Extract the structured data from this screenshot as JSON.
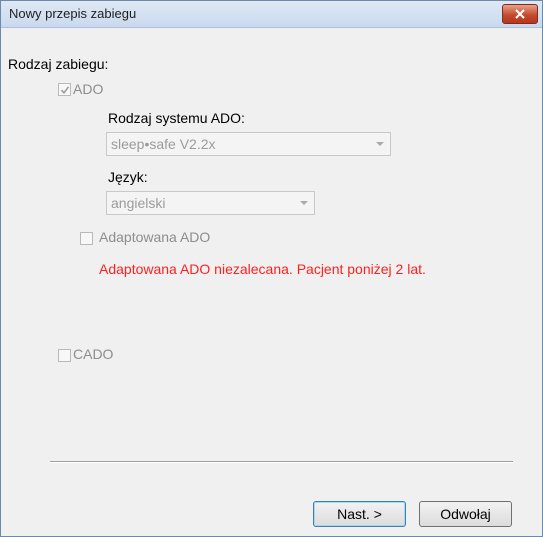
{
  "window": {
    "title": "Nowy przepis zabiegu"
  },
  "form": {
    "treatment_type_label": "Rodzaj zabiegu:",
    "ado": {
      "label": "ADO",
      "checked": true,
      "enabled": false
    },
    "ado_system": {
      "label": "Rodzaj systemu ADO:",
      "value": "sleep•safe V2.2x"
    },
    "language": {
      "label": "Język:",
      "value": "angielski"
    },
    "adapted_ado": {
      "label": "Adaptowana ADO",
      "checked": false,
      "enabled": false
    },
    "warning": "Adaptowana ADO niezalecana. Pacjent poniżej 2 lat.",
    "cado": {
      "label": "CADO",
      "checked": false,
      "enabled": false
    }
  },
  "buttons": {
    "next": "Nast. >",
    "cancel": "Odwołaj"
  },
  "colors": {
    "warning": "#ff1f1f",
    "disabled_text": "#8d8d8d",
    "close_button": "#c44b2f"
  }
}
